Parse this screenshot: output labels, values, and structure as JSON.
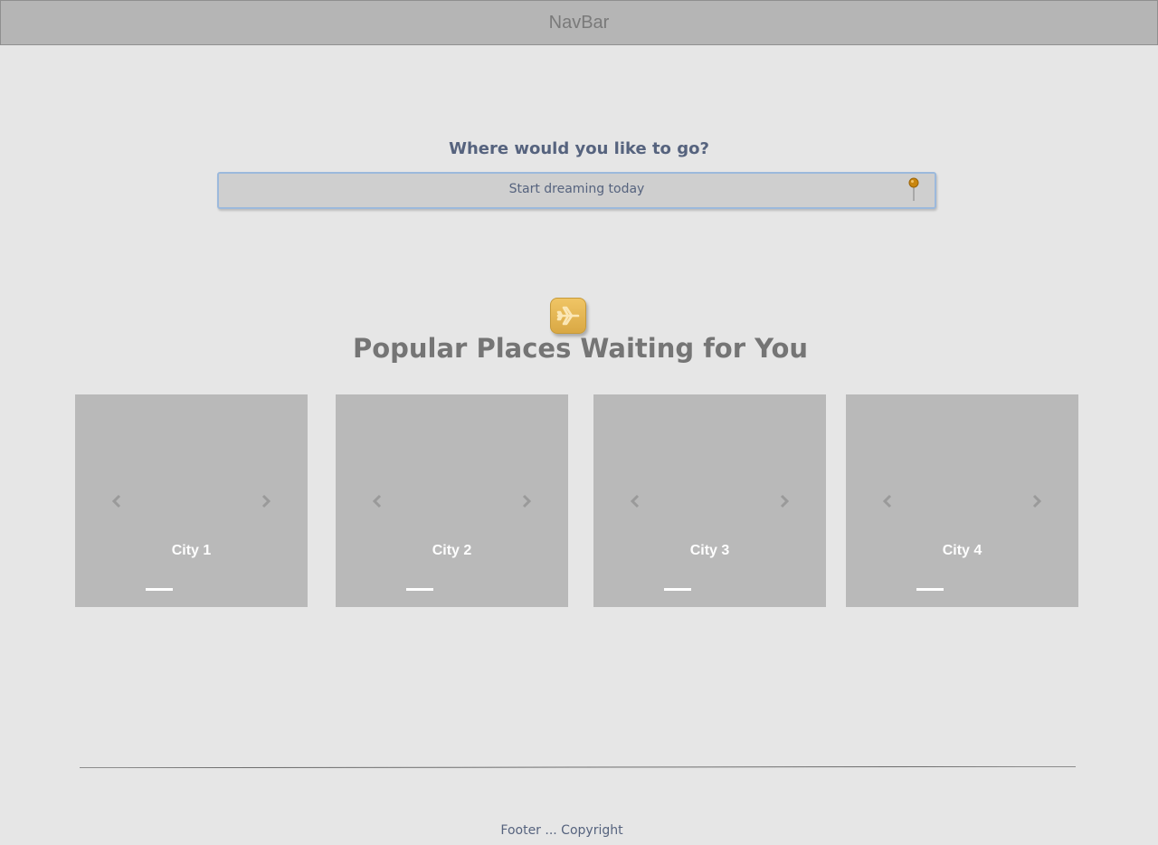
{
  "navbar": {
    "title": "NavBar"
  },
  "search": {
    "heading": "Where would you like to go?",
    "placeholder": "Start dreaming today",
    "value": "",
    "icon": "map-pin-icon"
  },
  "popular": {
    "badge_icon": "airplane-icon",
    "title": "Popular Places Waiting for You",
    "cards": [
      {
        "name": "City 1"
      },
      {
        "name": "City 2"
      },
      {
        "name": "City 3"
      },
      {
        "name": "City 4"
      }
    ]
  },
  "footer": {
    "text": "Footer ... Copyright"
  },
  "colors": {
    "page_background": "#e6e6e6",
    "navbar_background": "#b5b5b5",
    "heading_text": "#56637e",
    "section_title_text": "#757575",
    "card_background": "#b9b9b9",
    "badge_gold": "#e4b654",
    "input_border": "#9cb9dc"
  }
}
